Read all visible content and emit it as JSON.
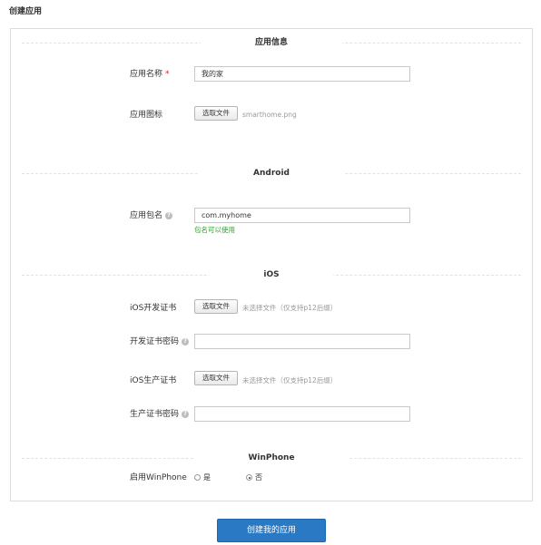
{
  "page": {
    "title": "创建应用"
  },
  "sections": {
    "app_info": "应用信息",
    "android": "Android",
    "ios": "iOS",
    "winphone": "WinPhone"
  },
  "app_info": {
    "name_label": "应用名称",
    "required_mark": "*",
    "name_value": "我的家",
    "icon_label": "应用图标",
    "icon_button": "选取文件",
    "icon_file": "smarthome.png"
  },
  "android": {
    "package_label": "应用包名",
    "package_value": "com.myhome",
    "package_status": "包名可以使用"
  },
  "ios": {
    "dev_cert_label": "iOS开发证书",
    "dev_cert_button": "选取文件",
    "dev_cert_hint": "未选择文件（仅支持p12后缀）",
    "dev_pwd_label": "开发证书密码",
    "dev_pwd_value": "",
    "prod_cert_label": "iOS生产证书",
    "prod_cert_button": "选取文件",
    "prod_cert_hint": "未选择文件（仅支持p12后缀）",
    "prod_pwd_label": "生产证书密码",
    "prod_pwd_value": ""
  },
  "winphone": {
    "enable_label": "启用WinPhone",
    "option_yes": "是",
    "option_no": "否",
    "selected": "否"
  },
  "help_icon": {
    "icon": "question-circle-icon",
    "glyph": "?"
  },
  "submit": {
    "label": "创建我的应用"
  },
  "colors": {
    "primary": "#2a79c4",
    "required": "#e02020",
    "success": "#3a9a3a"
  }
}
